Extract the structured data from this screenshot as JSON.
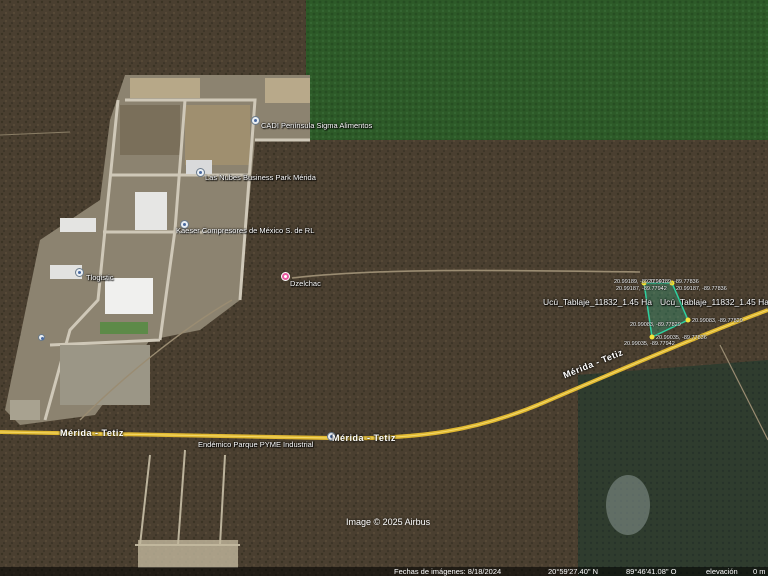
{
  "labels": {
    "cadi": "CADI Península Sigma Alimentos",
    "nubes": "Las Nubes Business Park Mérida",
    "kaeser": "Kaeser Compresores de México S. de RL",
    "tlogistic": "Tlogistic",
    "dzelchac": "Dzelchac",
    "endemico": "Endémico Parque PYME Industrial",
    "parcel1": "Ucú_Tablaje_11832_1.45 Ha",
    "parcel2": "Ucú_Tablaje_11832_1.45 Ha"
  },
  "roads": {
    "merida_tetiz_a": "Mérida - Tetiz",
    "merida_tetiz_b": "Mérida - Tetiz",
    "merida_tetiz_c": "Mérida - Tetiz"
  },
  "coords": {
    "c1": "20.99189, -89.77942",
    "c2": "20.99189, -89.77836",
    "c3": "20.99187, -89.77942",
    "c4": "20.99187, -89.77836",
    "c5": "20.99083, -89.77829",
    "c6": "20.99083, -89.77829",
    "c7": "20.99035, -89.77942",
    "c8": "20.99035, -89.77836"
  },
  "copyright": "Image © 2025 Airbus",
  "status": {
    "date": "Fechas de imágenes: 8/18/2024",
    "lat": "20°59'27.40\" N",
    "lon": "89°46'41.08\" O",
    "elev": "elevación",
    "elev_value": "0 m"
  },
  "colors": {
    "road": "#e0b830",
    "parcel": "#2fd0a0",
    "forest": "#2f5c2a"
  }
}
